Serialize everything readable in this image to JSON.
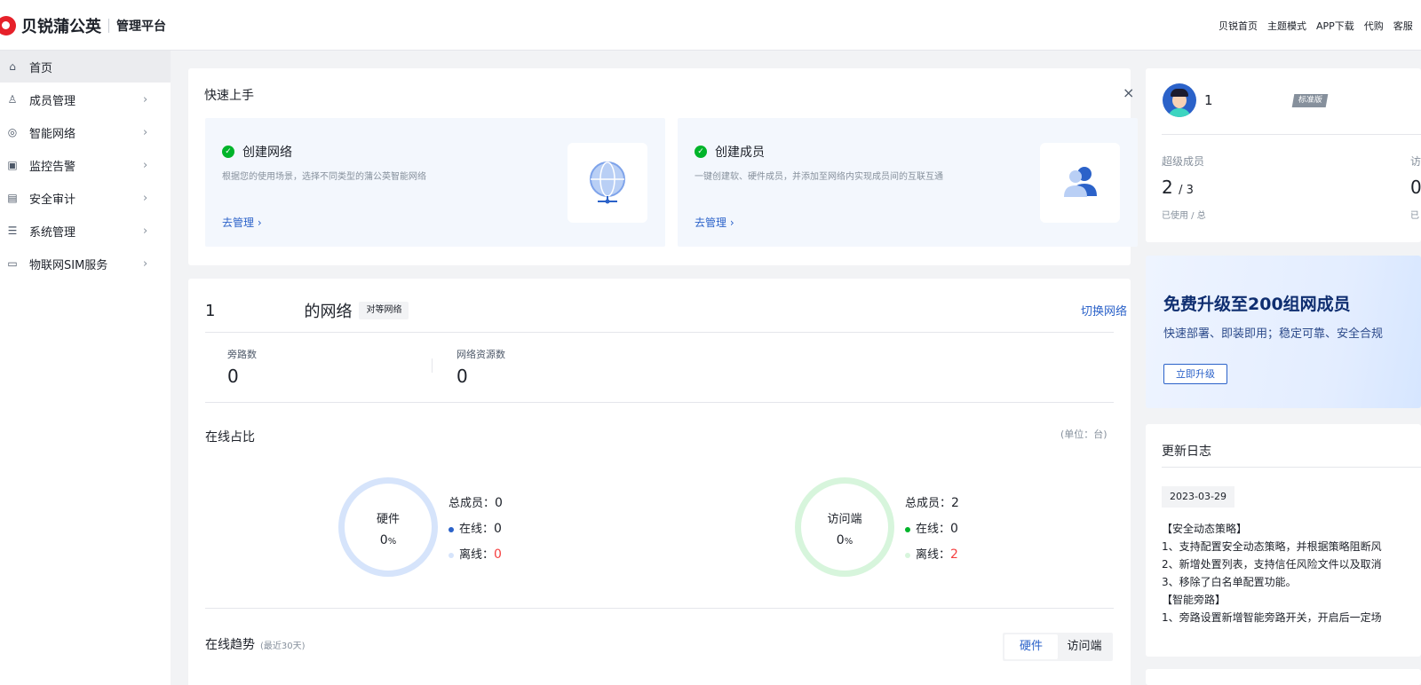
{
  "header": {
    "brand": "贝锐蒲公英",
    "subtitle": "管理平台",
    "links": [
      "贝锐首页",
      "主题模式",
      "APP下载",
      "代购",
      "客服"
    ]
  },
  "sidebar": {
    "items": [
      {
        "label": "首页",
        "icon": "home-icon",
        "active": true,
        "arrow": ""
      },
      {
        "label": "成员管理",
        "icon": "user-icon",
        "arrow": "›"
      },
      {
        "label": "智能网络",
        "icon": "network-icon",
        "arrow": "›"
      },
      {
        "label": "监控告警",
        "icon": "monitor-icon",
        "arrow": "›"
      },
      {
        "label": "安全审计",
        "icon": "audit-icon",
        "arrow": "›"
      },
      {
        "label": "系统管理",
        "icon": "settings-icon",
        "arrow": "›"
      },
      {
        "label": "物联网SIM服务",
        "icon": "sim-icon",
        "arrow": "›"
      }
    ]
  },
  "quickstart": {
    "title": "快速上手",
    "close": "×",
    "panels": [
      {
        "title": "创建网络",
        "desc": "根据您的使用场景，选择不同类型的蒲公英智能网络",
        "link": "去管理 ›",
        "icon": "globe-icon"
      },
      {
        "title": "创建成员",
        "desc": "一键创建软、硬件成员，并添加至网络内实现成员间的互联互通",
        "link": "去管理 ›",
        "icon": "members-icon"
      }
    ]
  },
  "network": {
    "title_prefix": "1",
    "title_suffix": "的网络",
    "tag": "对等网络",
    "switch": "切换网络",
    "stats": [
      {
        "label": "旁路数",
        "value": "0"
      },
      {
        "label": "网络资源数",
        "value": "0"
      }
    ],
    "online_title": "在线占比",
    "unit": "(单位：台)",
    "rings": [
      {
        "name": "硬件",
        "pct": "0",
        "pct_unit": "%",
        "color": "#d6e4fb",
        "online_dot": "#2b62c9",
        "total_label": "总成员：",
        "total": "0",
        "online_label": "在线：",
        "online": "0",
        "offline_label": "离线：",
        "offline": "0"
      },
      {
        "name": "访问端",
        "pct": "0",
        "pct_unit": "%",
        "color": "#d7f5dc",
        "online_dot": "#00b42a",
        "total_label": "总成员：",
        "total": "2",
        "online_label": "在线：",
        "online": "0",
        "offline_label": "离线：",
        "offline": "2"
      }
    ],
    "trend_title": "在线趋势",
    "trend_sub": "(最近30天)",
    "segments": [
      "硬件",
      "访问端"
    ]
  },
  "profile": {
    "name": "1",
    "badge": "标准版",
    "stats": [
      {
        "label": "超级成员",
        "used": "2",
        "total": "/ 3",
        "hint": "已使用 / 总"
      },
      {
        "label": "访",
        "used": "0",
        "total": "",
        "hint": "已"
      }
    ]
  },
  "promo": {
    "title": "免费升级至200组网成员",
    "desc": "快速部署、即装即用；稳定可靠、安全合规",
    "button": "立即升级"
  },
  "changelog": {
    "title": "更新日志",
    "date": "2023-03-29",
    "items": [
      "【安全动态策略】",
      "1、支持配置安全动态策略，并根据策略阻断风",
      "2、新增处置列表，支持信任风险文件以及取消",
      "3、移除了白名单配置功能。",
      "【智能旁路】",
      "1、旁路设置新增智能旁路开关，开启后一定场"
    ]
  }
}
